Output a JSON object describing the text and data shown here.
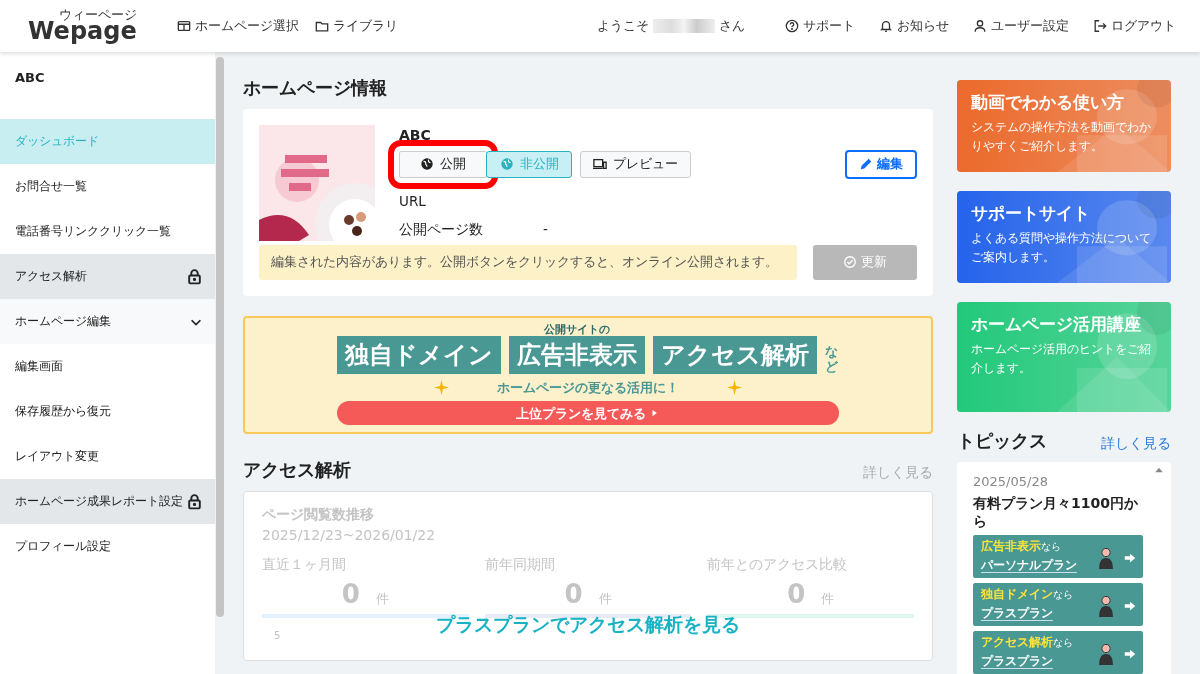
{
  "header": {
    "logo": "Wepage",
    "logo_ruby": "ウィーページ",
    "nav": [
      {
        "kind": "site",
        "label": "ホームページ選択"
      },
      {
        "kind": "folder",
        "label": "ライブラリ"
      }
    ],
    "welcome_prefix": "ようこそ",
    "welcome_suffix": "さん",
    "right_nav": [
      {
        "kind": "help",
        "label": "サポート"
      },
      {
        "kind": "bell",
        "label": "お知らせ"
      },
      {
        "kind": "user",
        "label": "ユーザー設定"
      },
      {
        "kind": "logout",
        "label": "ログアウト"
      }
    ]
  },
  "sidebar": {
    "site_name": "ABC",
    "items": [
      {
        "kind": "link",
        "label": "ダッシュボード",
        "selected": true
      },
      {
        "kind": "link",
        "label": "お問合せ一覧",
        "selected": false
      },
      {
        "kind": "link",
        "label": "電話番号リンククリック一覧",
        "selected": false
      },
      {
        "kind": "section",
        "label": "アクセス解析",
        "locked": true
      },
      {
        "kind": "group",
        "label": "ホームページ編集",
        "expanded": true,
        "children": [
          {
            "kind": "link",
            "label": "編集画面",
            "selected": false
          },
          {
            "kind": "link",
            "label": "保存履歴から復元",
            "selected": false
          },
          {
            "kind": "link",
            "label": "レイアウト変更",
            "selected": false
          }
        ]
      },
      {
        "kind": "section",
        "label": "ホームページ成果レポート設定",
        "locked": true
      },
      {
        "kind": "link",
        "label": "プロフィール設定",
        "selected": false
      }
    ]
  },
  "site_info": {
    "title": "ホームページ情報",
    "site_name": "ABC",
    "status_buttons": [
      {
        "label": "公開",
        "selected": false,
        "highlighted": true
      },
      {
        "label": "非公開",
        "selected": true,
        "highlighted": false
      }
    ],
    "preview": "プレビュー",
    "edit": "編集",
    "url_label": "URL",
    "pages_label": "公開ページ数",
    "pages_value": "-",
    "notice": "編集された内容があります。公開ボタンをクリックすると、オンライン公開されます。",
    "update": {
      "label": "更新",
      "disabled": true
    }
  },
  "banner": {
    "caption": "公開サイトの",
    "words": [
      "独自ドメイン",
      "広告非表示",
      "アクセス解析"
    ],
    "suffix": "など",
    "tagline": "ホームページの更なる活用に！",
    "cta": "上位プランを見てみる"
  },
  "access": {
    "title": "アクセス解析",
    "more": "詳しく見る",
    "chart_title": "ページ閲覧数推移",
    "range": "2025/12/23~2026/01/22",
    "stats": [
      {
        "label": "直近１ヶ月間",
        "value": "0",
        "unit": "件",
        "color": "#e3f2fd"
      },
      {
        "label": "前年同期間",
        "value": "0",
        "unit": "件",
        "color": "#e8eaf6"
      },
      {
        "label": "前年とのアクセス比較",
        "value": "0",
        "unit": "件",
        "color": "#e0f7ef"
      }
    ],
    "y_tick": "5",
    "overlay": "プラスプランでアクセス解析を見る"
  },
  "promos": [
    {
      "title": "動画でわかる使い方",
      "text": "システムの操作方法を動画でわかりやすくご紹介します。",
      "color": "#ec6a2c"
    },
    {
      "title": "サポートサイト",
      "text": "よくある質問や操作方法についてご案内します。",
      "color": "#2563eb"
    },
    {
      "title": "ホームページ活用講座",
      "text": "ホームページ活用のヒントをご紹介します。",
      "color": "#22c97a"
    }
  ],
  "topics": {
    "title": "トピックス",
    "more": "詳しく見る",
    "date": "2025/05/28",
    "headline": "有料プラン月々1100円から",
    "plans": [
      {
        "feature": "広告非表示",
        "suffix": "なら",
        "plan": "パーソナルプラン"
      },
      {
        "feature": "独自ドメイン",
        "suffix": "なら",
        "plan": "プラスプラン"
      },
      {
        "feature": "アクセス解析",
        "suffix": "なら",
        "plan": "プラスプラン"
      }
    ]
  }
}
